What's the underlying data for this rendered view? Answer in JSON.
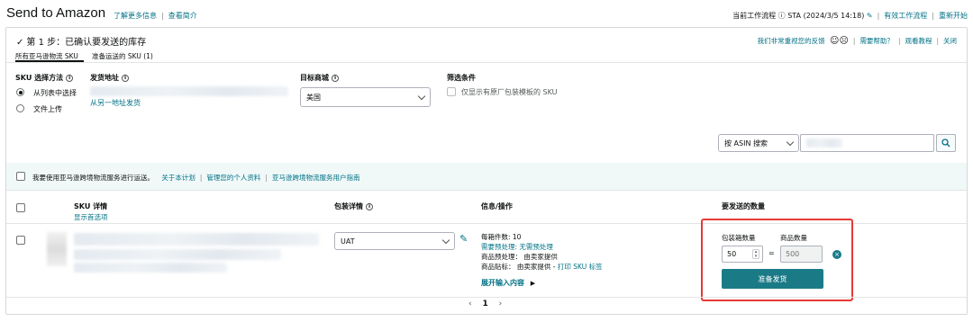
{
  "header": {
    "title": "Send to Amazon",
    "learn_more": "了解更多信息",
    "view_intro": "查看简介",
    "current_workflow": "当前工作流程 ⓘ STA (2024/3/5 14:18)",
    "active_workflow": "有效工作流程",
    "restart": "重新开始"
  },
  "step": {
    "check": "✓",
    "title": "第 1 步：已确认要发送的库存",
    "feedback": "我们非常重视您的反馈",
    "need_help": "需要帮助？",
    "watch_tutorial": "观看教程",
    "close": "关闭",
    "tabs": [
      "所有亚马逊物流 SKU",
      "准备运送的 SKU (1)"
    ]
  },
  "filters": {
    "sku_method_label": "SKU 选择方法",
    "method_options": [
      "从列表中选择",
      "文件上传"
    ],
    "ship_from_label": "发货地址",
    "ship_from_other": "从另一地址发货",
    "marketplace_label": "目标商城",
    "marketplace_value": "美国",
    "filter_label": "筛选条件",
    "filter_option": "仅显示有原厂包装模板的 SKU",
    "search_by": "按 ASIN 搜索"
  },
  "band": {
    "text": "我要使用亚马逊跨境物流服务进行运送。",
    "about": "关于本计划",
    "manage_profile": "管理您的个人资料",
    "user_guide": "亚马逊跨境物流服务用户指南"
  },
  "table": {
    "col_sku": "SKU 详情",
    "show_preferences": "显示首选项",
    "col_packing": "包装详情",
    "col_info": "信息/操作",
    "col_qty": "要发送的数量"
  },
  "row": {
    "packing_value": "UAT",
    "units_per_box": "每箱件数: 10",
    "prep_required": "需要预处理: 无需预处理",
    "prep_owner": "商品预处理：  由卖家提供",
    "label_owner": "商品贴标：  由卖家提供 -",
    "print_label": "打印 SKU 标签",
    "expand_input": "展开输入内容",
    "boxes_label": "包装箱数量",
    "units_label": "商品数量",
    "boxes_value": "50",
    "units_value": "500",
    "equals": "=",
    "ready_button": "准备发货"
  },
  "pagination": {
    "prev": "‹",
    "page": "1",
    "next": "›"
  },
  "colors": {
    "teal_link": "#007185",
    "primary_button": "#1a7b87",
    "highlight_box": "#e53935"
  }
}
